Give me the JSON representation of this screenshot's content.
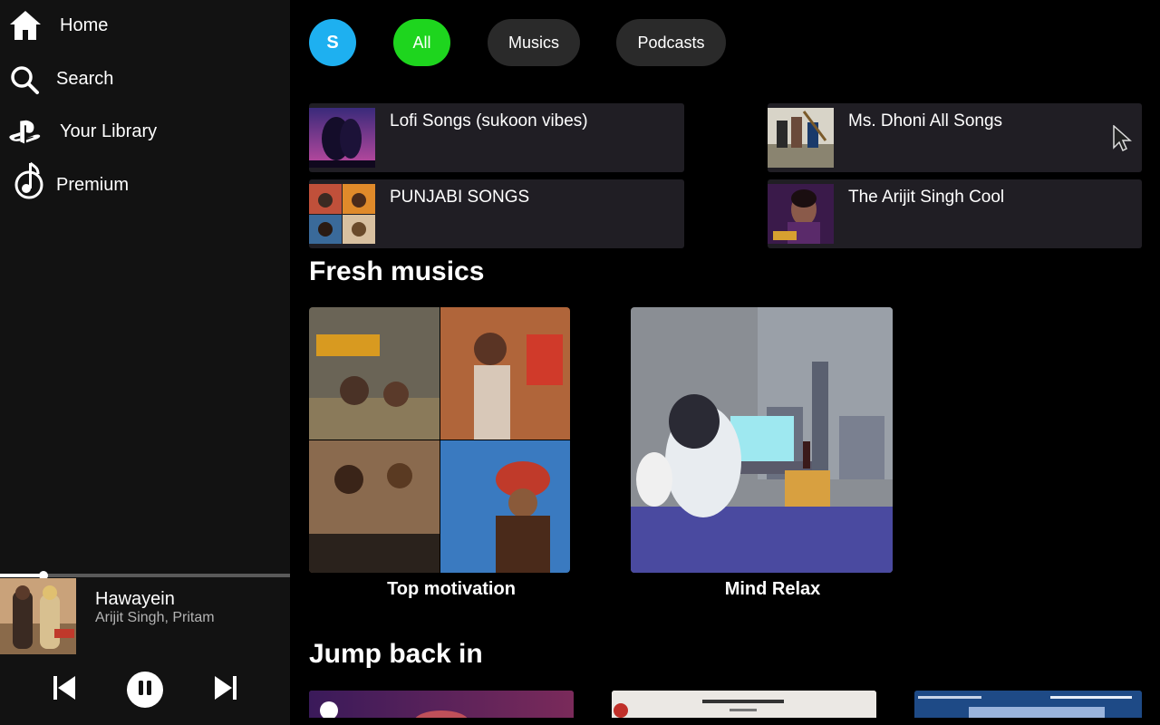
{
  "sidebar": {
    "nav": [
      {
        "label": "Home",
        "icon": "home-icon"
      },
      {
        "label": "Search",
        "icon": "search-icon"
      },
      {
        "label": "Your Library",
        "icon": "playstation-icon"
      },
      {
        "label": "Premium",
        "icon": "music-note-icon"
      }
    ]
  },
  "player": {
    "title": "Hawayein",
    "artist": "Arijit Singh, Pritam",
    "progress": 0.15,
    "controls": {
      "prev": "skip-previous-icon",
      "pause": "pause-icon",
      "next": "skip-next-icon"
    }
  },
  "header": {
    "avatar_letter": "S",
    "chips": [
      "All",
      "Musics",
      "Podcasts"
    ],
    "active_chip": "All"
  },
  "quick_picks": [
    {
      "label": "Lofi Songs (sukoon vibes)"
    },
    {
      "label": "Ms. Dhoni All Songs"
    },
    {
      "label": "PUNJABI SONGS"
    },
    {
      "label": "The Arijit Singh Cool"
    }
  ],
  "fresh": {
    "title": "Fresh musics",
    "cards": [
      {
        "caption": "Top motivation"
      },
      {
        "caption": "Mind Relax"
      }
    ]
  },
  "jump_back": {
    "title": "Jump back in"
  },
  "colors": {
    "accent_green": "#1ed51e",
    "avatar_blue": "#1eb0f0",
    "sidebar_bg": "#121212",
    "tile_bg": "#201e24"
  }
}
